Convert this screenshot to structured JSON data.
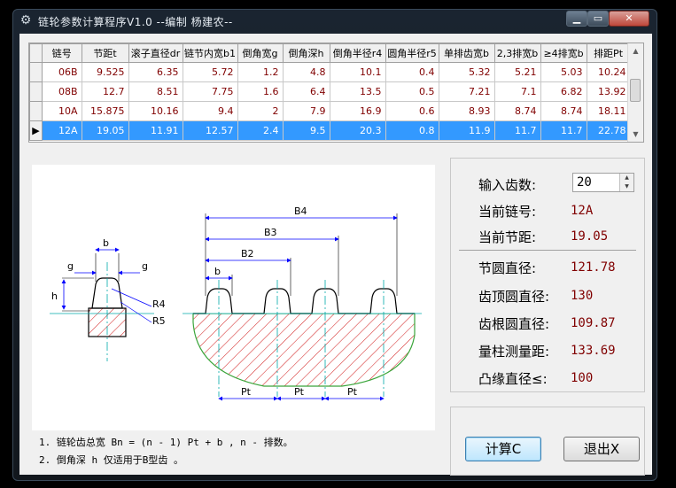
{
  "window": {
    "title": "链轮参数计算程序V1.0  --编制 杨建农--",
    "min_label": "▁",
    "max_label": "▭",
    "close_label": "✕"
  },
  "grid": {
    "headers": [
      "链号",
      "节距t",
      "滚子直径dr",
      "链节内宽b1",
      "倒角宽g",
      "倒角深h",
      "倒角半径r4",
      "圆角半径r5",
      "单排齿宽b",
      "2,3排宽b",
      "≥4排宽b",
      "排距Pt"
    ],
    "rows": [
      {
        "marker": "",
        "cells": [
          "06B",
          "9.525",
          "6.35",
          "5.72",
          "1.2",
          "4.8",
          "10.1",
          "0.4",
          "5.32",
          "5.21",
          "5.03",
          "10.24"
        ]
      },
      {
        "marker": "",
        "cells": [
          "08B",
          "12.7",
          "8.51",
          "7.75",
          "1.6",
          "6.4",
          "13.5",
          "0.5",
          "7.21",
          "7.1",
          "6.82",
          "13.92"
        ]
      },
      {
        "marker": "",
        "cells": [
          "10A",
          "15.875",
          "10.16",
          "9.4",
          "2",
          "7.9",
          "16.9",
          "0.6",
          "8.93",
          "8.74",
          "8.74",
          "18.11"
        ]
      },
      {
        "marker": "▶",
        "cells": [
          "12A",
          "19.05",
          "11.91",
          "12.57",
          "2.4",
          "9.5",
          "20.3",
          "0.8",
          "11.9",
          "11.7",
          "11.7",
          "22.78"
        ]
      }
    ],
    "selected_row": 3
  },
  "drawing": {
    "labels": {
      "b": "b",
      "g": "g",
      "h": "h",
      "r4": "R4",
      "r5": "R5",
      "b2": "B2",
      "b3": "B3",
      "b4": "B4",
      "pt": "Pt"
    }
  },
  "notes": [
    "1. 链轮齿总宽  Bn = (n - 1) Pt  + b , n - 排数。",
    "2. 倒角深 h 仅适用于B型齿 。"
  ],
  "results": {
    "teeth_label": "输入齿数:",
    "teeth_value": "20",
    "chain_label": "当前链号:",
    "chain_value": "12A",
    "pitch_label": "当前节距:",
    "pitch_value": "19.05",
    "pitch_diameter_label": "节圆直径:",
    "pitch_diameter_value": "121.78",
    "tip_diameter_label": "齿顶圆直径:",
    "tip_diameter_value": "130",
    "root_diameter_label": "齿根圆直径:",
    "root_diameter_value": "109.87",
    "measure_label": "量柱测量距:",
    "measure_value": "133.69",
    "flange_label": "凸缘直径≤:",
    "flange_value": "100"
  },
  "buttons": {
    "calc_label": "计算C",
    "exit_label": "退出X"
  },
  "colors": {
    "value_text": "#800000",
    "selection": "#3399ff",
    "dimension_line": "#0000ff",
    "hatch": "#cc0000",
    "center_line": "#00aaaa"
  }
}
